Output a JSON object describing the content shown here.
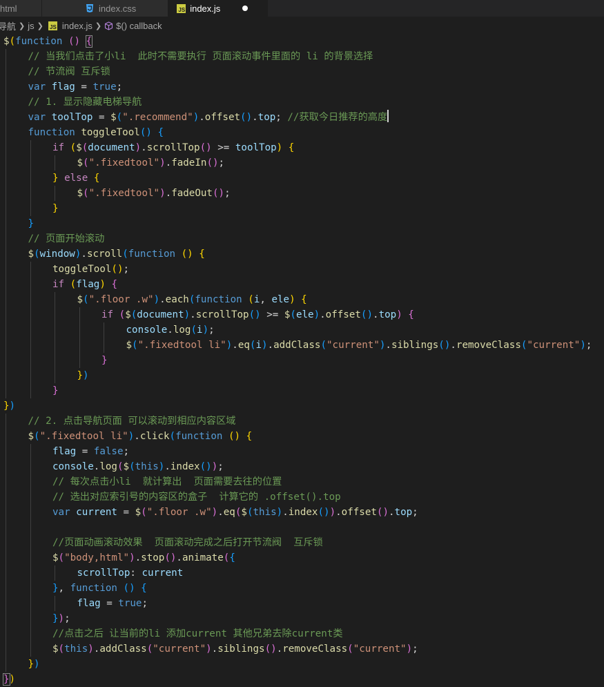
{
  "tabs": [
    {
      "label": "html",
      "icon": "html-file-icon",
      "active": false
    },
    {
      "label": "index.css",
      "icon": "css-file-icon",
      "active": false
    },
    {
      "label": "index.js",
      "icon": "js-file-icon",
      "active": true,
      "dirty": true
    }
  ],
  "breadcrumb": {
    "items": [
      "导航",
      "js",
      "index.js",
      "$() callback"
    ],
    "js_badge": "JS"
  },
  "colors": {
    "keyword": "#569cd6",
    "control": "#c586c0",
    "function": "#dcdcaa",
    "variable": "#9cdcfe",
    "string": "#ce9178",
    "comment": "#6a9955",
    "bracket1": "#ffd700",
    "bracket2": "#da70d6",
    "bracket3": "#179fff",
    "background": "#1e1e1e"
  },
  "code": [
    {
      "indent": 0,
      "tokens": [
        [
          "fn",
          "$"
        ],
        [
          "b1",
          "("
        ],
        [
          "kw",
          "function"
        ],
        [
          "pl",
          " "
        ],
        [
          "b2",
          "()"
        ],
        [
          "pl",
          " "
        ],
        [
          "b2box",
          "{"
        ]
      ]
    },
    {
      "indent": 1,
      "tokens": [
        [
          "com",
          "// 当我们点击了小li  此时不需要执行 页面滚动事件里面的 li 的背景选择"
        ]
      ]
    },
    {
      "indent": 1,
      "tokens": [
        [
          "com",
          "// 节流阀 互斥锁"
        ]
      ]
    },
    {
      "indent": 1,
      "tokens": [
        [
          "kw",
          "var"
        ],
        [
          "pl",
          " "
        ],
        [
          "var",
          "flag"
        ],
        [
          "pl",
          " = "
        ],
        [
          "kw",
          "true"
        ],
        [
          "pl",
          ";"
        ]
      ]
    },
    {
      "indent": 1,
      "tokens": [
        [
          "com",
          "// 1. 显示隐藏电梯导航"
        ]
      ]
    },
    {
      "indent": 1,
      "tokens": [
        [
          "kw",
          "var"
        ],
        [
          "pl",
          " "
        ],
        [
          "var",
          "toolTop"
        ],
        [
          "pl",
          " = "
        ],
        [
          "fn",
          "$"
        ],
        [
          "b3",
          "("
        ],
        [
          "str",
          "\".recommend\""
        ],
        [
          "b3",
          ")"
        ],
        [
          "pl",
          "."
        ],
        [
          "fn",
          "offset"
        ],
        [
          "b3",
          "()"
        ],
        [
          "pl",
          "."
        ],
        [
          "var",
          "top"
        ],
        [
          "pl",
          "; "
        ],
        [
          "com",
          "//获取今日推荐的高度"
        ],
        [
          "caret",
          ""
        ]
      ]
    },
    {
      "indent": 1,
      "tokens": [
        [
          "kw",
          "function"
        ],
        [
          "pl",
          " "
        ],
        [
          "fn",
          "toggleTool"
        ],
        [
          "b3",
          "()"
        ],
        [
          "pl",
          " "
        ],
        [
          "b3",
          "{"
        ]
      ]
    },
    {
      "indent": 2,
      "tokens": [
        [
          "ctl",
          "if"
        ],
        [
          "pl",
          " "
        ],
        [
          "b1",
          "("
        ],
        [
          "fn",
          "$"
        ],
        [
          "b2",
          "("
        ],
        [
          "var",
          "document"
        ],
        [
          "b2",
          ")"
        ],
        [
          "pl",
          "."
        ],
        [
          "fn",
          "scrollTop"
        ],
        [
          "b2",
          "()"
        ],
        [
          "pl",
          " >= "
        ],
        [
          "var",
          "toolTop"
        ],
        [
          "b1",
          ")"
        ],
        [
          "pl",
          " "
        ],
        [
          "b1",
          "{"
        ]
      ]
    },
    {
      "indent": 3,
      "tokens": [
        [
          "fn",
          "$"
        ],
        [
          "b2",
          "("
        ],
        [
          "str",
          "\".fixedtool\""
        ],
        [
          "b2",
          ")"
        ],
        [
          "pl",
          "."
        ],
        [
          "fn",
          "fadeIn"
        ],
        [
          "b2",
          "()"
        ],
        [
          "pl",
          ";"
        ]
      ]
    },
    {
      "indent": 2,
      "tokens": [
        [
          "b1",
          "}"
        ],
        [
          "pl",
          " "
        ],
        [
          "ctl",
          "else"
        ],
        [
          "pl",
          " "
        ],
        [
          "b1",
          "{"
        ]
      ]
    },
    {
      "indent": 3,
      "tokens": [
        [
          "fn",
          "$"
        ],
        [
          "b2",
          "("
        ],
        [
          "str",
          "\".fixedtool\""
        ],
        [
          "b2",
          ")"
        ],
        [
          "pl",
          "."
        ],
        [
          "fn",
          "fadeOut"
        ],
        [
          "b2",
          "()"
        ],
        [
          "pl",
          ";"
        ]
      ]
    },
    {
      "indent": 2,
      "tokens": [
        [
          "b1",
          "}"
        ]
      ]
    },
    {
      "indent": 1,
      "tokens": [
        [
          "b3",
          "}"
        ]
      ]
    },
    {
      "indent": 1,
      "tokens": [
        [
          "com",
          "// 页面开始滚动"
        ]
      ]
    },
    {
      "indent": 1,
      "tokens": [
        [
          "fn",
          "$"
        ],
        [
          "b3",
          "("
        ],
        [
          "var",
          "window"
        ],
        [
          "b3",
          ")"
        ],
        [
          "pl",
          "."
        ],
        [
          "fn",
          "scroll"
        ],
        [
          "b3",
          "("
        ],
        [
          "kw",
          "function"
        ],
        [
          "pl",
          " "
        ],
        [
          "b1",
          "()"
        ],
        [
          "pl",
          " "
        ],
        [
          "b1",
          "{"
        ]
      ]
    },
    {
      "indent": 2,
      "tokens": [
        [
          "fn",
          "toggleTool"
        ],
        [
          "b1",
          "()"
        ],
        [
          "pl",
          ";"
        ]
      ]
    },
    {
      "indent": 2,
      "tokens": [
        [
          "ctl",
          "if"
        ],
        [
          "pl",
          " "
        ],
        [
          "b1",
          "("
        ],
        [
          "var",
          "flag"
        ],
        [
          "b1",
          ")"
        ],
        [
          "pl",
          " "
        ],
        [
          "b2",
          "{"
        ]
      ]
    },
    {
      "indent": 3,
      "tokens": [
        [
          "fn",
          "$"
        ],
        [
          "b3",
          "("
        ],
        [
          "str",
          "\".floor .w\""
        ],
        [
          "b3",
          ")"
        ],
        [
          "pl",
          "."
        ],
        [
          "fn",
          "each"
        ],
        [
          "b3",
          "("
        ],
        [
          "kw",
          "function"
        ],
        [
          "pl",
          " "
        ],
        [
          "b1",
          "("
        ],
        [
          "var",
          "i"
        ],
        [
          "pl",
          ", "
        ],
        [
          "var",
          "ele"
        ],
        [
          "b1",
          ")"
        ],
        [
          "pl",
          " "
        ],
        [
          "b1",
          "{"
        ]
      ]
    },
    {
      "indent": 4,
      "tokens": [
        [
          "ctl",
          "if"
        ],
        [
          "pl",
          " "
        ],
        [
          "b2",
          "("
        ],
        [
          "fn",
          "$"
        ],
        [
          "b3",
          "("
        ],
        [
          "var",
          "document"
        ],
        [
          "b3",
          ")"
        ],
        [
          "pl",
          "."
        ],
        [
          "fn",
          "scrollTop"
        ],
        [
          "b3",
          "()"
        ],
        [
          "pl",
          " >= "
        ],
        [
          "fn",
          "$"
        ],
        [
          "b3",
          "("
        ],
        [
          "var",
          "ele"
        ],
        [
          "b3",
          ")"
        ],
        [
          "pl",
          "."
        ],
        [
          "fn",
          "offset"
        ],
        [
          "b3",
          "()"
        ],
        [
          "pl",
          "."
        ],
        [
          "var",
          "top"
        ],
        [
          "b2",
          ")"
        ],
        [
          "pl",
          " "
        ],
        [
          "b2",
          "{"
        ]
      ]
    },
    {
      "indent": 5,
      "tokens": [
        [
          "var",
          "console"
        ],
        [
          "pl",
          "."
        ],
        [
          "fn",
          "log"
        ],
        [
          "b3",
          "("
        ],
        [
          "var",
          "i"
        ],
        [
          "b3",
          ")"
        ],
        [
          "pl",
          ";"
        ]
      ]
    },
    {
      "indent": 5,
      "tokens": [
        [
          "fn",
          "$"
        ],
        [
          "b3",
          "("
        ],
        [
          "str",
          "\".fixedtool li\""
        ],
        [
          "b3",
          ")"
        ],
        [
          "pl",
          "."
        ],
        [
          "fn",
          "eq"
        ],
        [
          "b3",
          "("
        ],
        [
          "var",
          "i"
        ],
        [
          "b3",
          ")"
        ],
        [
          "pl",
          "."
        ],
        [
          "fn",
          "addClass"
        ],
        [
          "b3",
          "("
        ],
        [
          "str",
          "\"current\""
        ],
        [
          "b3",
          ")"
        ],
        [
          "pl",
          "."
        ],
        [
          "fn",
          "siblings"
        ],
        [
          "b3",
          "()"
        ],
        [
          "pl",
          "."
        ],
        [
          "fn",
          "removeClass"
        ],
        [
          "b3",
          "("
        ],
        [
          "str",
          "\"current\""
        ],
        [
          "b3",
          ")"
        ],
        [
          "pl",
          ";"
        ]
      ]
    },
    {
      "indent": 4,
      "tokens": [
        [
          "b2",
          "}"
        ]
      ]
    },
    {
      "indent": 3,
      "tokens": [
        [
          "b1",
          "}"
        ],
        [
          "b3",
          ")"
        ]
      ]
    },
    {
      "indent": 2,
      "tokens": [
        [
          "b2",
          "}"
        ]
      ]
    },
    {
      "indent": 0,
      "tokens": [
        [
          "b1",
          "}"
        ],
        [
          "b3",
          ")"
        ]
      ]
    },
    {
      "indent": 1,
      "tokens": [
        [
          "com",
          "// 2. 点击导航页面 可以滚动到相应内容区域"
        ]
      ]
    },
    {
      "indent": 1,
      "tokens": [
        [
          "fn",
          "$"
        ],
        [
          "b3",
          "("
        ],
        [
          "str",
          "\".fixedtool li\""
        ],
        [
          "b3",
          ")"
        ],
        [
          "pl",
          "."
        ],
        [
          "fn",
          "click"
        ],
        [
          "b3",
          "("
        ],
        [
          "kw",
          "function"
        ],
        [
          "pl",
          " "
        ],
        [
          "b1",
          "()"
        ],
        [
          "pl",
          " "
        ],
        [
          "b1",
          "{"
        ]
      ]
    },
    {
      "indent": 2,
      "tokens": [
        [
          "var",
          "flag"
        ],
        [
          "pl",
          " = "
        ],
        [
          "kw",
          "false"
        ],
        [
          "pl",
          ";"
        ]
      ]
    },
    {
      "indent": 2,
      "tokens": [
        [
          "var",
          "console"
        ],
        [
          "pl",
          "."
        ],
        [
          "fn",
          "log"
        ],
        [
          "b2",
          "("
        ],
        [
          "fn",
          "$"
        ],
        [
          "b3",
          "("
        ],
        [
          "kw",
          "this"
        ],
        [
          "b3",
          ")"
        ],
        [
          "pl",
          "."
        ],
        [
          "fn",
          "index"
        ],
        [
          "b3",
          "()"
        ],
        [
          "b2",
          ")"
        ],
        [
          "pl",
          ";"
        ]
      ]
    },
    {
      "indent": 2,
      "tokens": [
        [
          "com",
          "// 每次点击小li  就计算出  页面需要去往的位置"
        ]
      ]
    },
    {
      "indent": 2,
      "tokens": [
        [
          "com",
          "// 选出对应索引号的内容区的盒子  计算它的 .offset().top"
        ]
      ]
    },
    {
      "indent": 2,
      "tokens": [
        [
          "kw",
          "var"
        ],
        [
          "pl",
          " "
        ],
        [
          "var",
          "current"
        ],
        [
          "pl",
          " = "
        ],
        [
          "fn",
          "$"
        ],
        [
          "b2",
          "("
        ],
        [
          "str",
          "\".floor .w\""
        ],
        [
          "b2",
          ")"
        ],
        [
          "pl",
          "."
        ],
        [
          "fn",
          "eq"
        ],
        [
          "b2",
          "("
        ],
        [
          "fn",
          "$"
        ],
        [
          "b3",
          "("
        ],
        [
          "kw",
          "this"
        ],
        [
          "b3",
          ")"
        ],
        [
          "pl",
          "."
        ],
        [
          "fn",
          "index"
        ],
        [
          "b3",
          "()"
        ],
        [
          "b2",
          ")"
        ],
        [
          "pl",
          "."
        ],
        [
          "fn",
          "offset"
        ],
        [
          "b2",
          "()"
        ],
        [
          "pl",
          "."
        ],
        [
          "var",
          "top"
        ],
        [
          "pl",
          ";"
        ]
      ]
    },
    {
      "indent": 0,
      "tokens": []
    },
    {
      "indent": 2,
      "tokens": [
        [
          "com",
          "//页面动画滚动效果  页面滚动完成之后打开节流阀  互斥锁"
        ]
      ]
    },
    {
      "indent": 2,
      "tokens": [
        [
          "fn",
          "$"
        ],
        [
          "b2",
          "("
        ],
        [
          "str",
          "\"body,html\""
        ],
        [
          "b2",
          ")"
        ],
        [
          "pl",
          "."
        ],
        [
          "fn",
          "stop"
        ],
        [
          "b2",
          "()"
        ],
        [
          "pl",
          "."
        ],
        [
          "fn",
          "animate"
        ],
        [
          "b2",
          "("
        ],
        [
          "b3",
          "{"
        ]
      ]
    },
    {
      "indent": 3,
      "tokens": [
        [
          "var",
          "scrollTop"
        ],
        [
          "pl",
          ": "
        ],
        [
          "var",
          "current"
        ]
      ]
    },
    {
      "indent": 2,
      "tokens": [
        [
          "b3",
          "}"
        ],
        [
          "pl",
          ", "
        ],
        [
          "kw",
          "function"
        ],
        [
          "pl",
          " "
        ],
        [
          "b3",
          "()"
        ],
        [
          "pl",
          " "
        ],
        [
          "b3",
          "{"
        ]
      ]
    },
    {
      "indent": 3,
      "tokens": [
        [
          "var",
          "flag"
        ],
        [
          "pl",
          " = "
        ],
        [
          "kw",
          "true"
        ],
        [
          "pl",
          ";"
        ]
      ]
    },
    {
      "indent": 2,
      "tokens": [
        [
          "b3",
          "}"
        ],
        [
          "b2",
          ")"
        ],
        [
          "pl",
          ";"
        ]
      ]
    },
    {
      "indent": 2,
      "tokens": [
        [
          "com",
          "//点击之后 让当前的li 添加current 其他兄弟去除current类"
        ]
      ]
    },
    {
      "indent": 2,
      "tokens": [
        [
          "fn",
          "$"
        ],
        [
          "b2",
          "("
        ],
        [
          "kw",
          "this"
        ],
        [
          "b2",
          ")"
        ],
        [
          "pl",
          "."
        ],
        [
          "fn",
          "addClass"
        ],
        [
          "b2",
          "("
        ],
        [
          "str",
          "\"current\""
        ],
        [
          "b2",
          ")"
        ],
        [
          "pl",
          "."
        ],
        [
          "fn",
          "siblings"
        ],
        [
          "b2",
          "()"
        ],
        [
          "pl",
          "."
        ],
        [
          "fn",
          "removeClass"
        ],
        [
          "b2",
          "("
        ],
        [
          "str",
          "\"current\""
        ],
        [
          "b2",
          ")"
        ],
        [
          "pl",
          ";"
        ]
      ]
    },
    {
      "indent": 1,
      "tokens": [
        [
          "b1",
          "}"
        ],
        [
          "b3",
          ")"
        ]
      ]
    },
    {
      "indent": 0,
      "tokens": [
        [
          "b2box",
          "}"
        ],
        [
          "b1",
          ")"
        ]
      ]
    }
  ]
}
